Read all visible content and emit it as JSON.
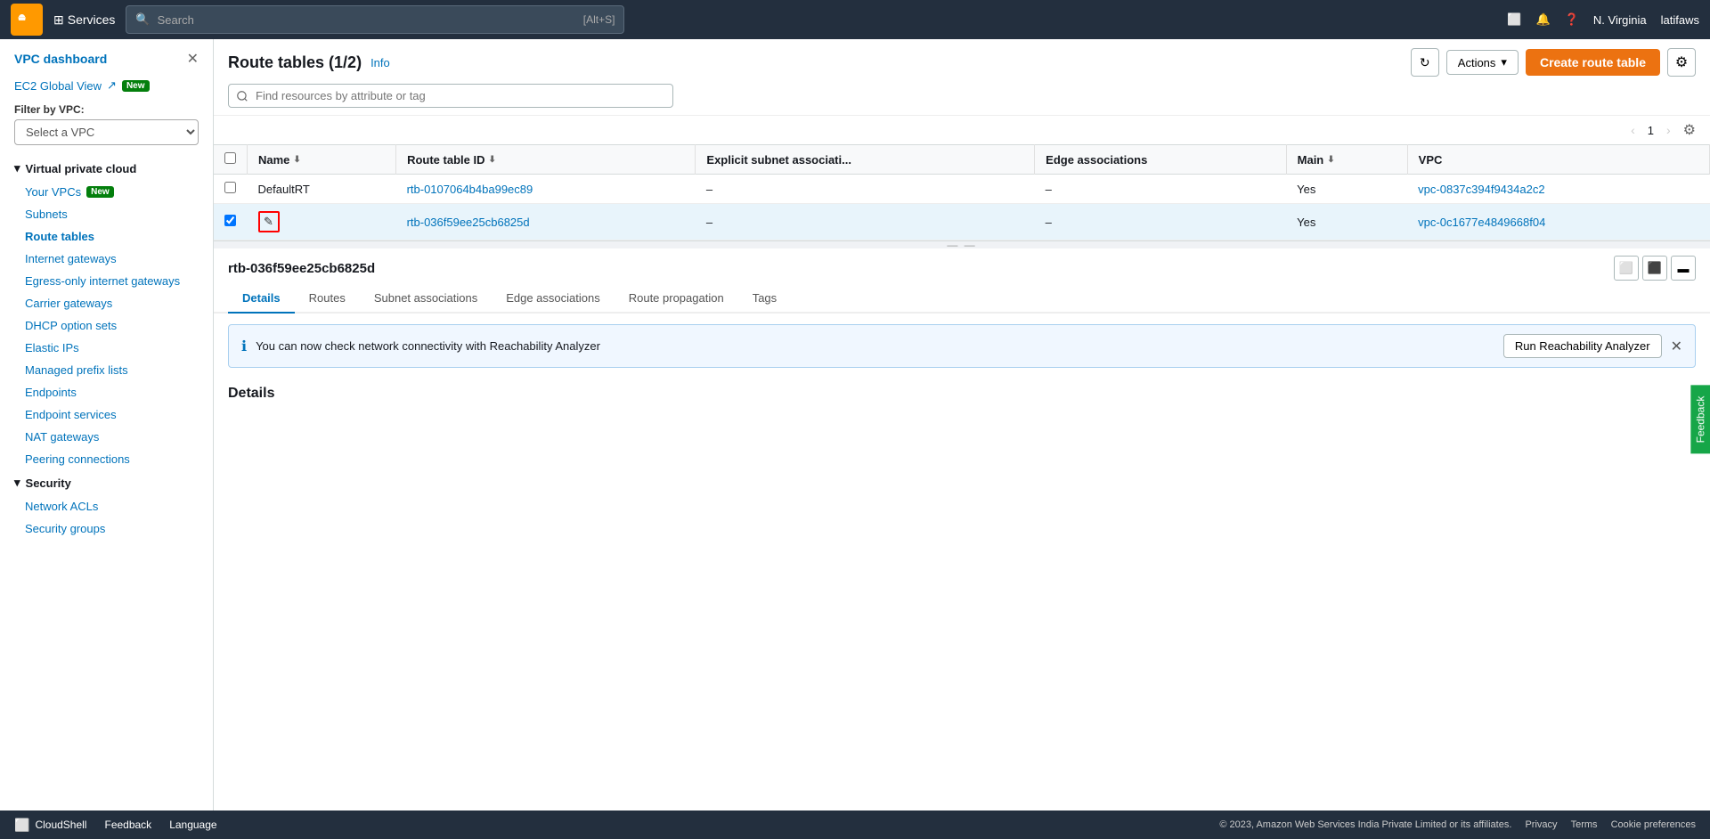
{
  "topnav": {
    "logo": "aws",
    "services_label": "Services",
    "search_placeholder": "Search",
    "search_shortcut": "[Alt+S]",
    "region": "N. Virginia",
    "user": "latifaws"
  },
  "sidebar": {
    "vpc_dashboard": "VPC dashboard",
    "ec2_global_view": "EC2 Global View",
    "new_badge": "New",
    "filter_label": "Filter by VPC:",
    "filter_placeholder": "Select a VPC",
    "sections": [
      {
        "name": "Virtual private cloud",
        "items": [
          {
            "label": "Your VPCs",
            "badge": "New",
            "active": false
          },
          {
            "label": "Subnets",
            "active": false
          },
          {
            "label": "Route tables",
            "active": true
          },
          {
            "label": "Internet gateways",
            "active": false
          },
          {
            "label": "Egress-only internet gateways",
            "active": false
          },
          {
            "label": "Carrier gateways",
            "active": false
          },
          {
            "label": "DHCP option sets",
            "active": false
          },
          {
            "label": "Elastic IPs",
            "active": false
          },
          {
            "label": "Managed prefix lists",
            "active": false
          },
          {
            "label": "Endpoints",
            "active": false
          },
          {
            "label": "Endpoint services",
            "active": false
          },
          {
            "label": "NAT gateways",
            "active": false
          },
          {
            "label": "Peering connections",
            "active": false
          }
        ]
      },
      {
        "name": "Security",
        "items": [
          {
            "label": "Network ACLs",
            "active": false
          },
          {
            "label": "Security groups",
            "active": false
          }
        ]
      }
    ]
  },
  "table": {
    "title": "Route tables",
    "count": "(1/2)",
    "info_link": "Info",
    "search_placeholder": "Find resources by attribute or tag",
    "actions_label": "Actions",
    "create_label": "Create route table",
    "columns": [
      {
        "id": "name",
        "label": "Name",
        "sortable": true
      },
      {
        "id": "route_table_id",
        "label": "Route table ID",
        "sortable": true
      },
      {
        "id": "explicit_subnet",
        "label": "Explicit subnet associati...",
        "sortable": false
      },
      {
        "id": "edge_assoc",
        "label": "Edge associations",
        "sortable": false
      },
      {
        "id": "main",
        "label": "Main",
        "sortable": true
      },
      {
        "id": "vpc",
        "label": "VPC",
        "sortable": false
      }
    ],
    "rows": [
      {
        "id": "row1",
        "selected": false,
        "name": "DefaultRT",
        "route_table_id": "rtb-0107064b4ba99ec89",
        "explicit_subnet": "–",
        "edge_assoc": "–",
        "main": "Yes",
        "vpc": "vpc-0837c394f9434a2c2"
      },
      {
        "id": "row2",
        "selected": true,
        "name": "",
        "route_table_id": "rtb-036f59ee25cb6825d",
        "explicit_subnet": "–",
        "edge_assoc": "–",
        "main": "Yes",
        "vpc": "vpc-0c1677e4849668f04"
      }
    ],
    "pagination": {
      "current_page": 1,
      "prev_disabled": true,
      "next_disabled": true
    }
  },
  "detail_panel": {
    "resource_id": "rtb-036f59ee25cb6825d",
    "tabs": [
      {
        "id": "details",
        "label": "Details",
        "active": true
      },
      {
        "id": "routes",
        "label": "Routes",
        "active": false
      },
      {
        "id": "subnet_assoc",
        "label": "Subnet associations",
        "active": false
      },
      {
        "id": "edge_assoc",
        "label": "Edge associations",
        "active": false
      },
      {
        "id": "route_prop",
        "label": "Route propagation",
        "active": false
      },
      {
        "id": "tags",
        "label": "Tags",
        "active": false
      }
    ],
    "info_banner": {
      "text": "You can now check network connectivity with Reachability Analyzer",
      "run_button": "Run Reachability Analyzer"
    },
    "details_heading": "Details"
  },
  "bottom_bar": {
    "cloudshell": "CloudShell",
    "feedback": "Feedback",
    "language": "Language",
    "copyright": "© 2023, Amazon Web Services India Private Limited or its affiliates.",
    "privacy": "Privacy",
    "terms": "Terms",
    "cookie_prefs": "Cookie preferences"
  },
  "feedback_tab": "Feedback"
}
